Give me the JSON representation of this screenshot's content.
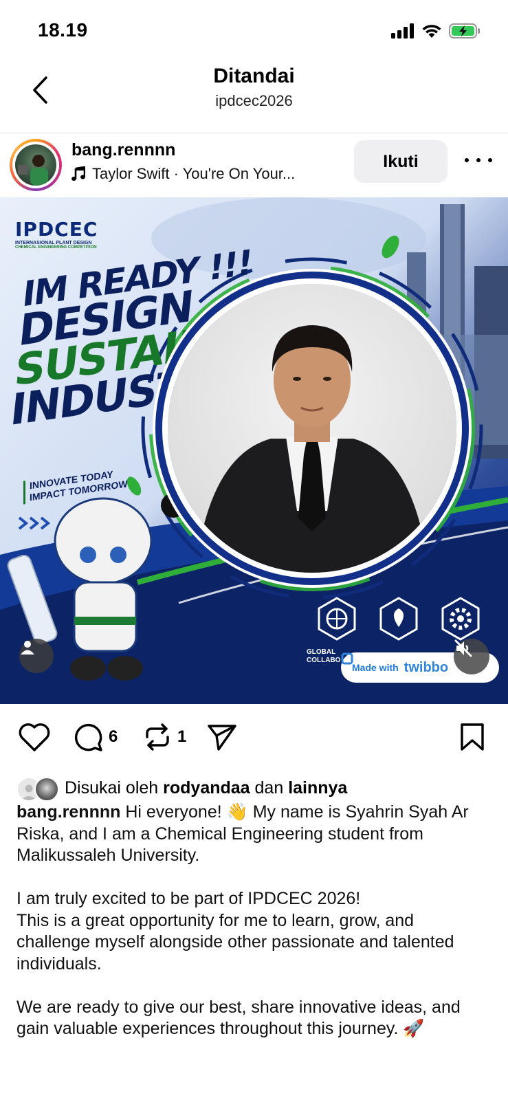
{
  "status_bar": {
    "time": "18.19"
  },
  "nav": {
    "title": "Ditandai",
    "subtitle": "ipdcec2026"
  },
  "post": {
    "username": "bang.rennnn",
    "music": "Taylor Swift · You're On Your...",
    "follow_label": "Ikuti",
    "image": {
      "logo": "IPDCEC",
      "logo_sub": "INTERNASIONAL PLANT DESIGN",
      "logo_sub2": "CHEMICAL ENGINEERING COMPETITION",
      "headline_1": "IM READY !!!",
      "headline_2": "DESIGN",
      "headline_3": "SUSTAIN",
      "headline_4": "INDUSTRY",
      "tagline_1": "INNOVATE TODAY",
      "tagline_2": "IMPACT TOMORROW",
      "badge_1": "GLOBAL",
      "badge_2": "COLLABO",
      "made_with": "Made with",
      "made_with_brand": "twibbo"
    },
    "comments_count": "6",
    "reposts_count": "1",
    "liked_by_prefix": "Disukai oleh ",
    "liked_by_user": "rodyandaa",
    "liked_by_mid": " dan ",
    "liked_by_others": "lainnya",
    "caption_user": "bang.rennnn",
    "caption_text": " Hi everyone! 👋 My name is Syahrin Syah Ar Riska, and I am a Chemical Engineering student from Malikussaleh University.\n\nI am truly excited to be part of IPDCEC 2026!\nThis is a great opportunity for me to learn, grow, and challenge myself alongside other passionate and talented individuals.\n\nWe are ready to give our best, share innovative ideas, and gain valuable experiences throughout this journey. 🚀"
  },
  "colors": {
    "battery_green": "#34c759",
    "ring_gradient": [
      "#f9a11b",
      "#e1306c",
      "#833ab4"
    ],
    "follow_bg": "#efeff2"
  }
}
